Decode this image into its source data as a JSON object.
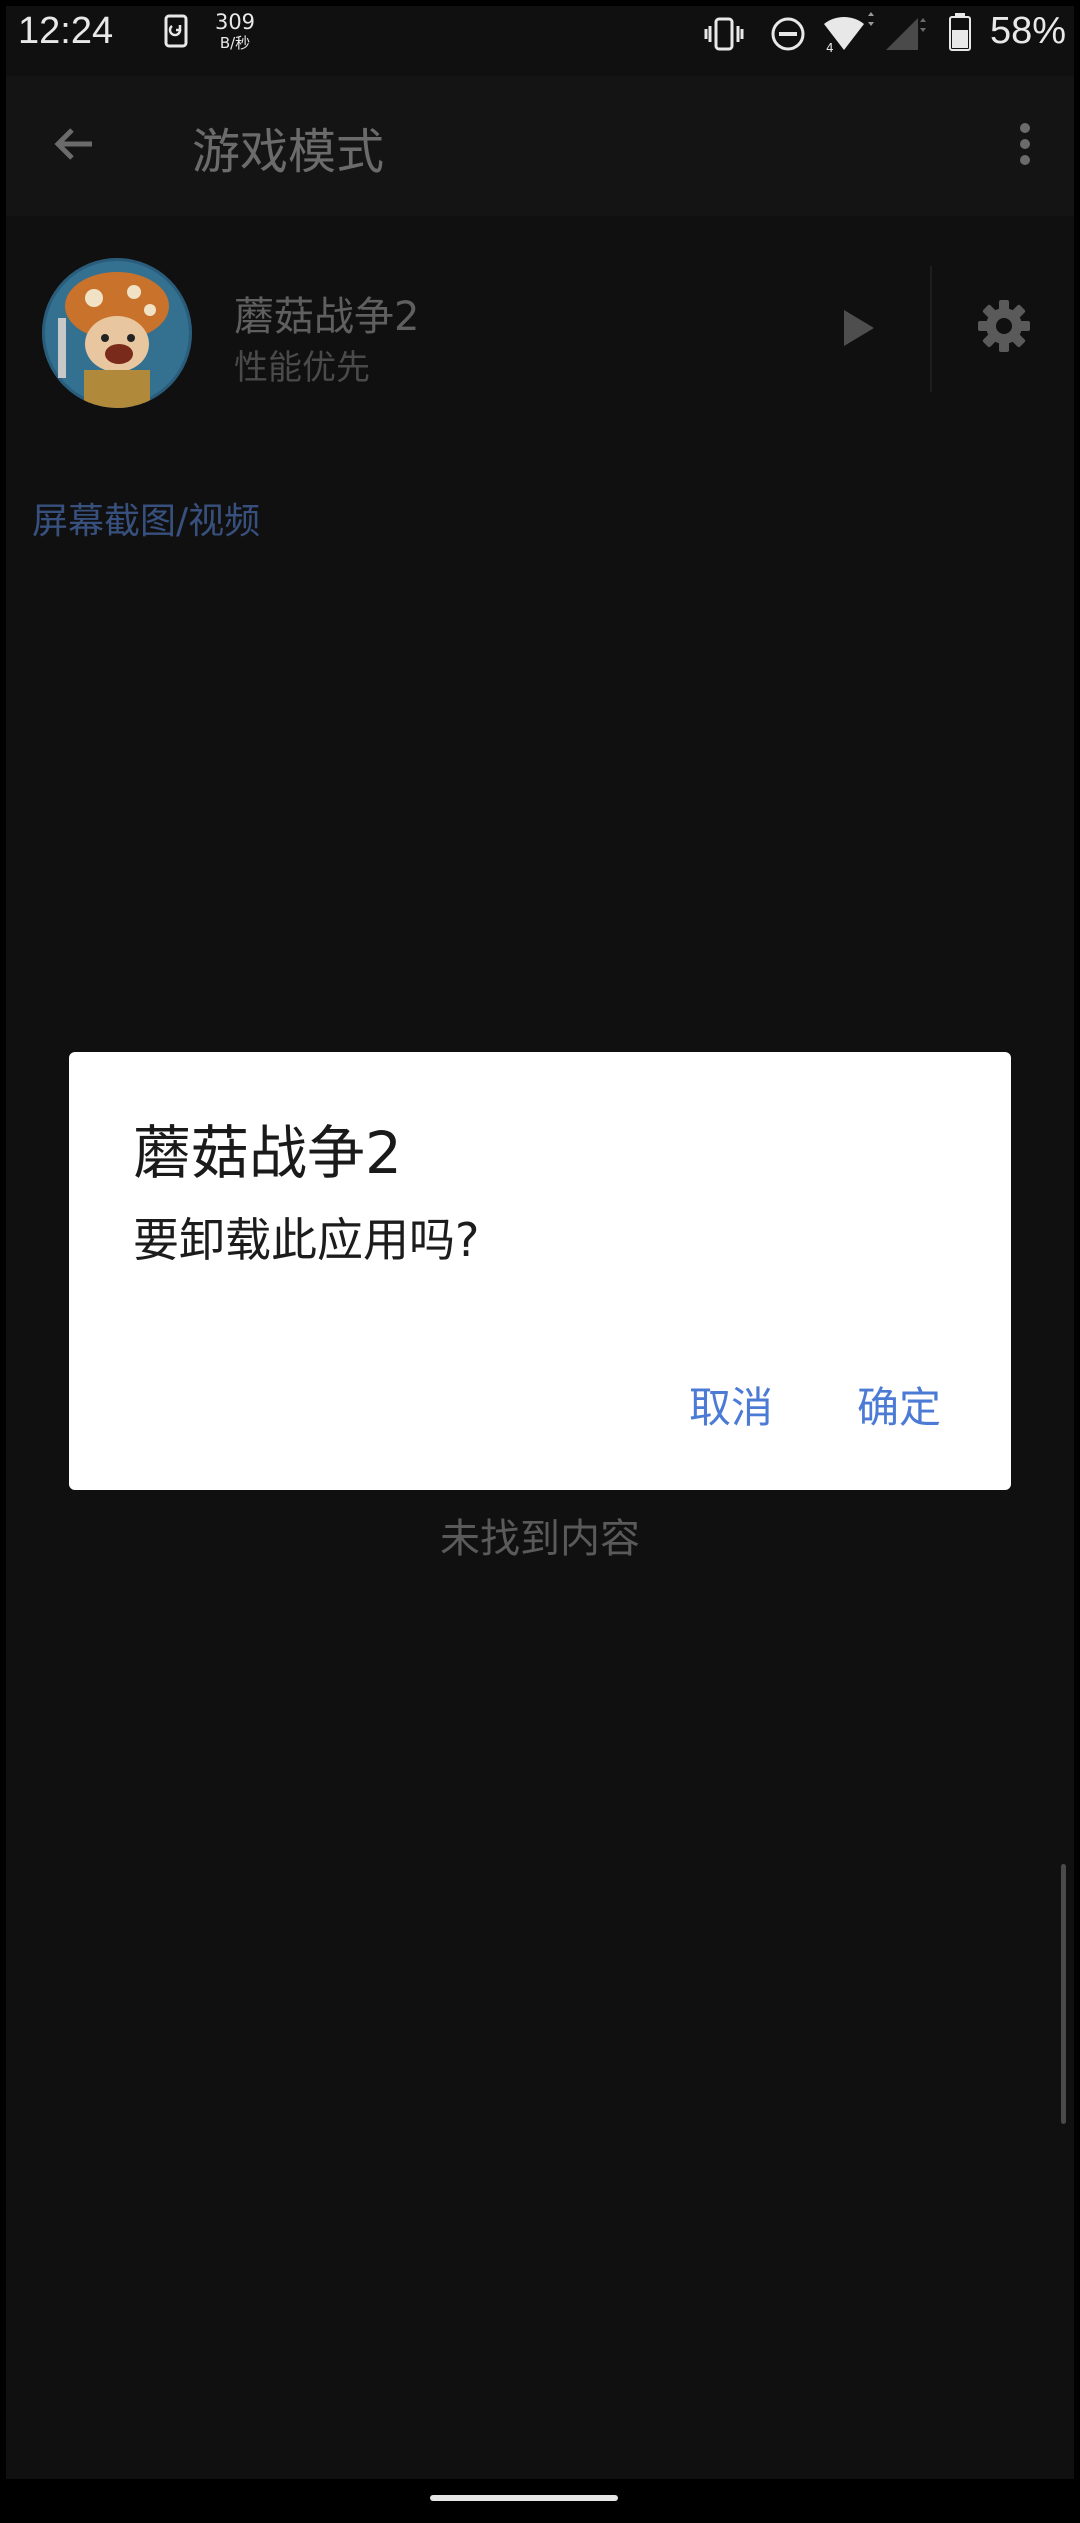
{
  "status_bar": {
    "time": "12:24",
    "net_speed_value": "309",
    "net_speed_unit": "B/秒",
    "wifi_badge": "4",
    "battery_percent": "58%",
    "battery_level": 0.58,
    "icons": [
      "sim-icon",
      "vibrate-icon",
      "do-not-disturb-icon",
      "wifi-icon",
      "cellular-signal-icon",
      "battery-icon"
    ]
  },
  "app_bar": {
    "title": "游戏模式",
    "icons": [
      "back-arrow-icon",
      "more-vert-icon"
    ]
  },
  "game": {
    "name": "蘑菇战争2",
    "mode": "性能优先",
    "icons": [
      "game-avatar",
      "play-icon",
      "gear-icon"
    ]
  },
  "section": {
    "label": "屏幕截图/视频",
    "empty_text": "未找到内容"
  },
  "dialog": {
    "title": "蘑菇战争2",
    "message": "要卸载此应用吗?",
    "cancel_label": "取消",
    "ok_label": "确定"
  },
  "colors": {
    "background": "#101010",
    "dialog_background": "#ffffff",
    "accent": "#4c7bd6",
    "muted_link": "#38507e"
  }
}
